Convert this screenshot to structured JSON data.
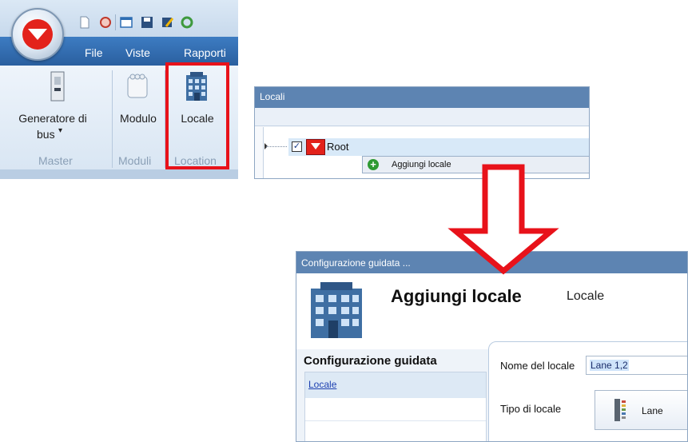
{
  "ribbon": {
    "tabs": [
      "File",
      "Viste",
      "Rapporti"
    ],
    "buttons": {
      "generatore_line1": "Generatore di",
      "generatore_line2": "bus",
      "generatore_arrow": "▾",
      "modulo": "Modulo",
      "locale": "Locale"
    },
    "groups": [
      "Master",
      "Moduli",
      "Location"
    ],
    "highlight_color": "#e8121a"
  },
  "locali_panel": {
    "title": "Locali",
    "root_label": "Root",
    "root_checked": true,
    "context_menu_item": "Aggiungi locale"
  },
  "wizard": {
    "title": "Configurazione guidata ...",
    "heading": "Aggiungi locale",
    "subheading": "Locale",
    "left_title": "Configurazione guidata",
    "steps": [
      "Locale"
    ],
    "nome_label": "Nome del locale",
    "nome_value": "Lane 1,2",
    "tipo_label": "Tipo di locale",
    "tipo_value": "Lane"
  },
  "colors": {
    "accent_blue": "#2a5f9f",
    "arrow_red": "#e8121a",
    "brand_red": "#e3221b"
  }
}
